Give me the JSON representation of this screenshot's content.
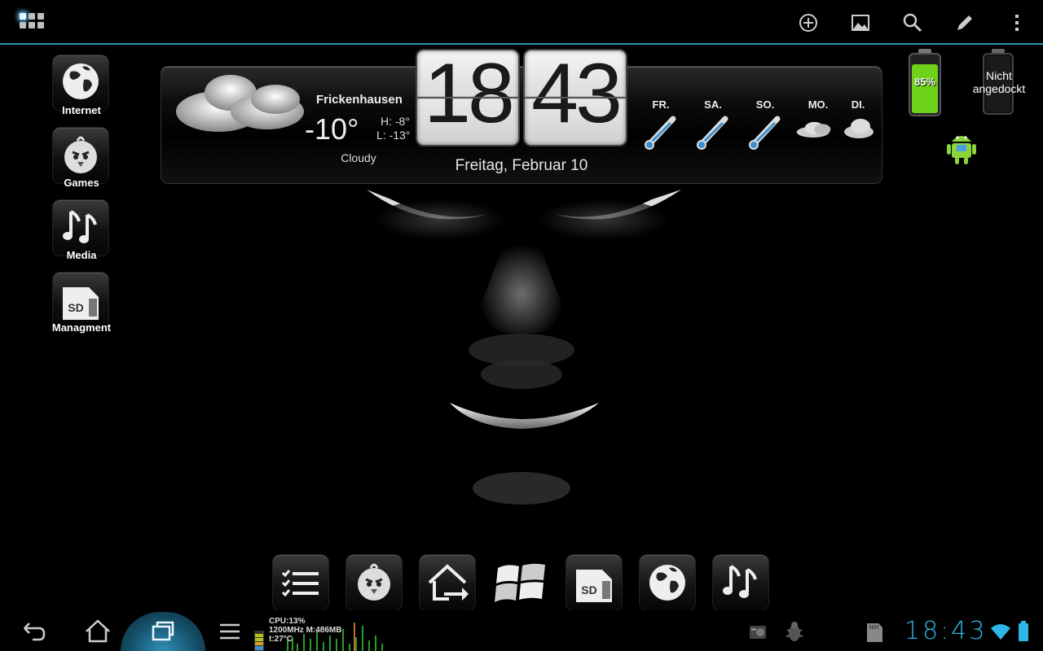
{
  "top_bar": {
    "apps_icon": "apps-grid-icon",
    "actions": [
      {
        "icon": "add-widget-icon",
        "name": "add"
      },
      {
        "icon": "wallpaper-icon",
        "name": "wallpaper"
      },
      {
        "icon": "search-icon",
        "name": "search"
      },
      {
        "icon": "edit-icon",
        "name": "edit"
      },
      {
        "icon": "overflow-menu-icon",
        "name": "menu"
      }
    ],
    "accent_color": "#2c8fb0"
  },
  "shortcuts": [
    {
      "label": "Internet",
      "icon": "globe-icon"
    },
    {
      "label": "Games",
      "icon": "angry-bird-icon"
    },
    {
      "label": "Media",
      "icon": "music-notes-icon"
    },
    {
      "label": "Managment",
      "icon": "sd-card-icon"
    }
  ],
  "weather": {
    "city": "Frickenhausen",
    "temperature": "-10°",
    "high": "H: -8°",
    "low": "L: -13°",
    "condition": "Cloudy",
    "icon": "cloud-icon"
  },
  "clock": {
    "hours": "18",
    "minutes": "43",
    "date": "Freitag, Februar 10"
  },
  "forecast": [
    {
      "day": "FR.",
      "icon": "thermometer-cold-icon"
    },
    {
      "day": "SA.",
      "icon": "thermometer-cold-icon"
    },
    {
      "day": "SO.",
      "icon": "thermometer-cold-icon"
    },
    {
      "day": "MO.",
      "icon": "cloud-icon"
    },
    {
      "day": "DI.",
      "icon": "cloud-icon"
    }
  ],
  "battery_widget": {
    "level": "85%",
    "level_fraction": 0.85,
    "color": "#6fd21a"
  },
  "dock_widget": {
    "status": "Nicht angedockt"
  },
  "dock": [
    {
      "icon": "checklist-icon"
    },
    {
      "icon": "angry-bird-icon"
    },
    {
      "icon": "home-arrow-icon"
    },
    {
      "icon": "windows-logo-icon"
    },
    {
      "icon": "sd-card-icon"
    },
    {
      "icon": "globe-icon"
    },
    {
      "icon": "music-notes-icon"
    }
  ],
  "system_bar": {
    "buttons": [
      "back-icon",
      "home-icon",
      "recent-apps-icon",
      "menu-icon"
    ],
    "cpu_line1": "CPU:13%",
    "cpu_line2": "1200MHz M:486MB",
    "cpu_line3": "t:27°C",
    "time": "18:43",
    "status_icons": [
      "audio-icon",
      "bug-icon",
      "sd-card-icon",
      "wifi-icon",
      "battery-icon"
    ],
    "accent_color": "#2fb6e8"
  }
}
